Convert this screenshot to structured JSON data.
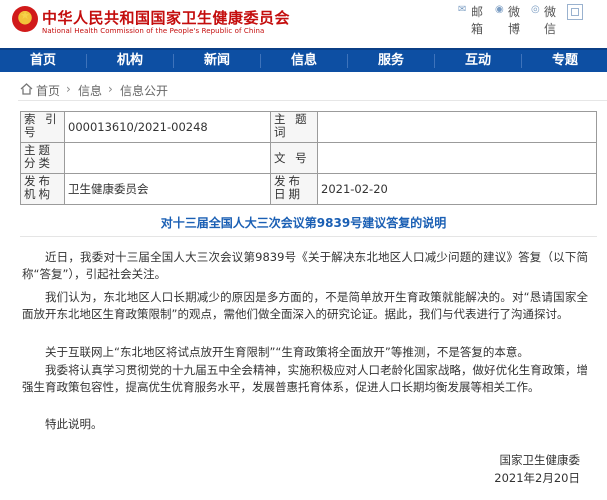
{
  "header": {
    "site_title": "中华人民共和国国家卫生健康委员会",
    "site_subtitle": "National Health Commission of the People's Republic of China",
    "tools": [
      {
        "icon": "mail-icon",
        "top": "邮",
        "bottom": "箱"
      },
      {
        "icon": "weibo-icon",
        "top": "微",
        "bottom": "博"
      },
      {
        "icon": "wechat-icon",
        "top": "微",
        "bottom": "信"
      }
    ],
    "font_size_icon": "font-size-icon"
  },
  "nav": {
    "items": [
      "首页",
      "机构",
      "新闻",
      "信息",
      "服务",
      "互动",
      "专题"
    ]
  },
  "breadcrumb": [
    "首页",
    "信息",
    "信息公开"
  ],
  "meta": {
    "index_label": "索 引 号",
    "index_value": "000013610/2021-00248",
    "topic_label": "主 题 词",
    "topic_value": "",
    "category_label": "主题分类",
    "category_value": "",
    "docno_label": "文 号",
    "docno_value": "",
    "publisher_label": "发布机构",
    "publisher_value": "卫生健康委员会",
    "date_label": "发布日期",
    "date_value": "2021-02-20"
  },
  "article": {
    "title": "对十三届全国人大三次会议第9839号建议答复的说明",
    "paragraphs": [
      "近日，我委对十三届全国人大三次会议第9839号《关于解决东北地区人口减少问题的建议》答复（以下简称“答复”），引起社会关注。",
      "我们认为，东北地区人口长期减少的原因是多方面的，不是简单放开生育政策就能解决的。对“恳请国家全面放开东北地区生育政策限制”的观点，需他们做全面深入的研究论证。据此，我们与代表进行了沟通探讨。",
      "关于互联网上“东北地区将试点放开生育限制”“生育政策将全面放开”等推测，不是答复的本意。",
      "我委将认真学习贯彻党的十九届五中全会精神，实施积极应对人口老龄化国家战略，做好优化生育政策，增强生育政策包容性，提高优生优育服务水平，发展普惠托育体系，促进人口长期均衡发展等相关工作。",
      "特此说明。"
    ],
    "signature": "国家卫生健康委",
    "date": "2021年2月20日"
  },
  "colors": {
    "brand_red": "#c40d0d",
    "nav_blue": "#0d4fa3",
    "title_blue": "#1a5fb4"
  }
}
